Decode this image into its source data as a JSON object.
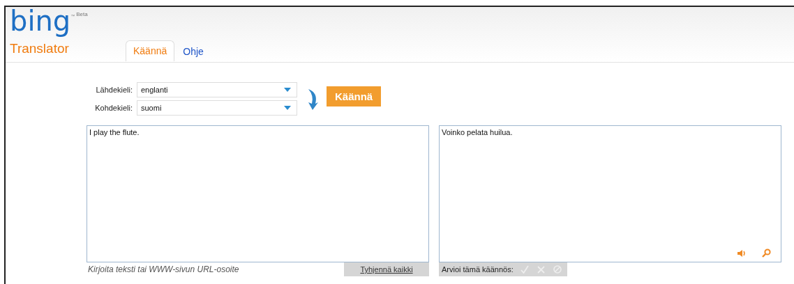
{
  "logo": {
    "wordmark": "bing",
    "tm": "™",
    "badge": "Beta",
    "product": "Translator"
  },
  "tabs": [
    {
      "label": "Käännä",
      "selected": true
    },
    {
      "label": "Ohje",
      "selected": false
    }
  ],
  "languages": [
    {
      "label": "Lähdekieli:",
      "value": "englanti"
    },
    {
      "label": "Kohdekieli:",
      "value": "suomi"
    }
  ],
  "translate_button": "Käännä",
  "source": {
    "value": "I play the flute.",
    "hint": "Kirjoita teksti tai WWW-sivun URL-osoite",
    "clear_button": "Tyhjennä kaikki"
  },
  "target": {
    "value": "Voinko pelata huilua.",
    "rate_label": "Arvioi tämä käännös:"
  }
}
